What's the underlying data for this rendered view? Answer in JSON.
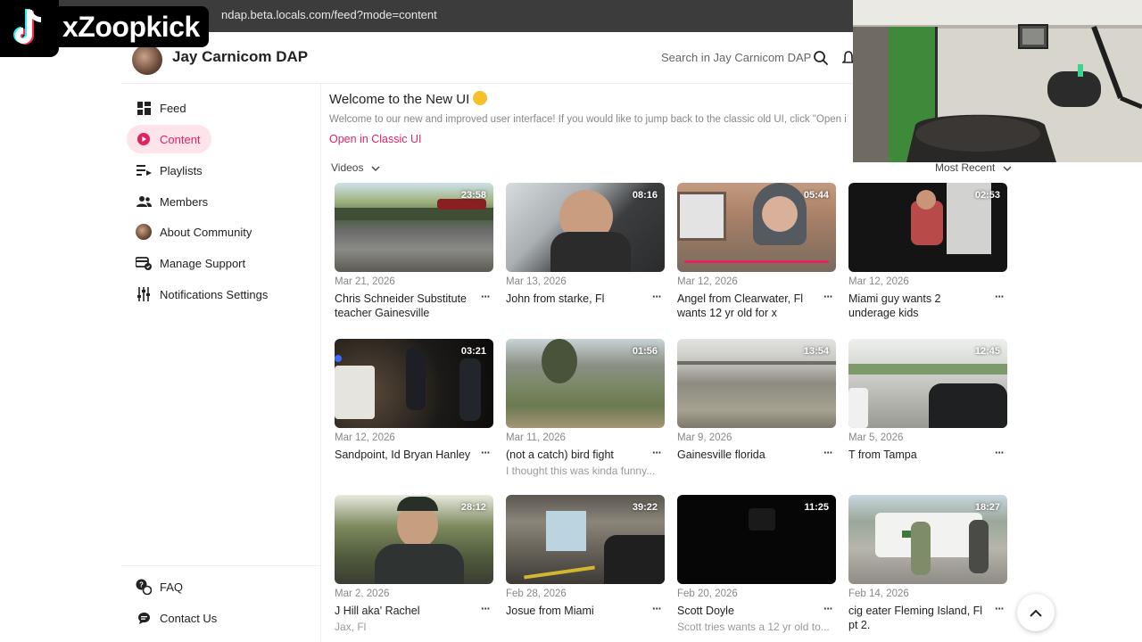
{
  "browser": {
    "url": "ndap.beta.locals.com/feed?mode=content"
  },
  "overlay": {
    "tiktok_handle": "xZoopkick"
  },
  "header": {
    "community_name": "Jay Carnicom DAP",
    "search_placeholder": "Search in Jay Carnicom DAP"
  },
  "sidebar": {
    "items": [
      {
        "label": "Feed",
        "icon": "grid-icon",
        "active": false
      },
      {
        "label": "Content",
        "icon": "play-icon",
        "active": true
      },
      {
        "label": "Playlists",
        "icon": "playlist-icon",
        "active": false
      },
      {
        "label": "Members",
        "icon": "members-icon",
        "active": false
      },
      {
        "label": "About Community",
        "icon": "community-avatar",
        "active": false
      },
      {
        "label": "Manage Support",
        "icon": "support-icon",
        "active": false
      },
      {
        "label": "Notifications Settings",
        "icon": "sliders-icon",
        "active": false
      }
    ],
    "bottom_items": [
      {
        "label": "FAQ",
        "icon": "faq-icon"
      },
      {
        "label": "Contact Us",
        "icon": "chat-icon"
      }
    ]
  },
  "main": {
    "welcome_title": "Welcome to the New UI",
    "welcome_body": "Welcome to our new and improved user interface! If you would like to jump back to the classic old UI, click \"Open i",
    "classic_link": "Open in Classic UI",
    "filter_label": "Videos",
    "sort_label": "Most Recent",
    "accent_color": "#e0245e",
    "videos": [
      {
        "duration": "23:58",
        "date": "Mar 21, 2026",
        "title": "Chris Schneider Substitute teacher Gainesville",
        "desc": ""
      },
      {
        "duration": "08:16",
        "date": "Mar 13, 2026",
        "title": "John from starke, Fl",
        "desc": ""
      },
      {
        "duration": "05:44",
        "date": "Mar 12, 2026",
        "title": "Angel from Clearwater, Fl wants 12 yr old for x",
        "desc": ""
      },
      {
        "duration": "02:53",
        "date": "Mar 12, 2026",
        "title": "Miami guy wants 2 underage kids",
        "desc": ""
      },
      {
        "duration": "03:21",
        "date": "Mar 12, 2026",
        "title": "Sandpoint, Id Bryan Hanley",
        "desc": ""
      },
      {
        "duration": "01:56",
        "date": "Mar 11, 2026",
        "title": "(not a catch) bird fight",
        "desc": "I thought this was kinda funny..."
      },
      {
        "duration": "13:54",
        "date": "Mar 9, 2026",
        "title": "Gainesville florida",
        "desc": ""
      },
      {
        "duration": "12:45",
        "date": "Mar 5, 2026",
        "title": "T from Tampa",
        "desc": ""
      },
      {
        "duration": "28:12",
        "date": "Mar 2, 2026",
        "title": "J Hill aka' Rachel",
        "desc": "Jax, Fl"
      },
      {
        "duration": "39:22",
        "date": "Feb 28, 2026",
        "title": "Josue from Miami",
        "desc": ""
      },
      {
        "duration": "11:25",
        "date": "Feb 20, 2026",
        "title": "Scott Doyle",
        "desc": "Scott tries wants a 12 yr old to..."
      },
      {
        "duration": "18:27",
        "date": "Feb 14, 2026",
        "title": "cig eater Fleming Island, Fl pt 2.",
        "desc": ""
      }
    ],
    "more_label": "···"
  }
}
